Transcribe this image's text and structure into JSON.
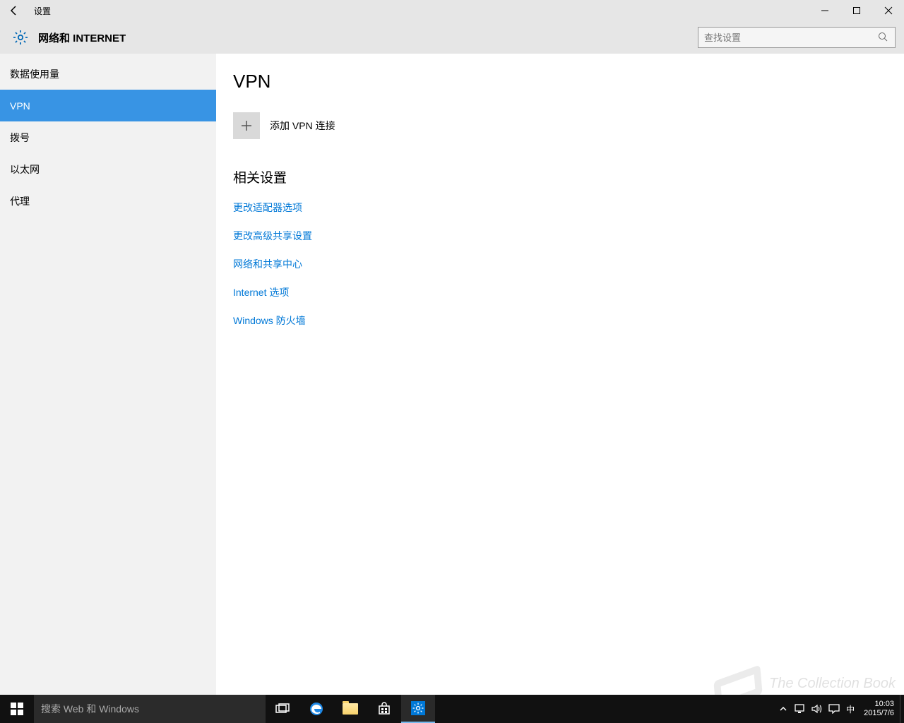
{
  "titlebar": {
    "title": "设置"
  },
  "header": {
    "title": "网络和 INTERNET",
    "search_placeholder": "查找设置"
  },
  "sidebar": {
    "items": [
      {
        "label": "数据使用量",
        "selected": false
      },
      {
        "label": "VPN",
        "selected": true
      },
      {
        "label": "拨号",
        "selected": false
      },
      {
        "label": "以太网",
        "selected": false
      },
      {
        "label": "代理",
        "selected": false
      }
    ]
  },
  "main": {
    "heading": "VPN",
    "add_label": "添加 VPN 连接",
    "related_heading": "相关设置",
    "links": [
      "更改适配器选项",
      "更改高级共享设置",
      "网络和共享中心",
      "Internet 选项",
      "Windows 防火墙"
    ]
  },
  "taskbar": {
    "search_placeholder": "搜索 Web 和 Windows",
    "ime_label": "中",
    "time": "10:03",
    "date": "2015/7/6"
  },
  "watermark": "The Collection Book"
}
